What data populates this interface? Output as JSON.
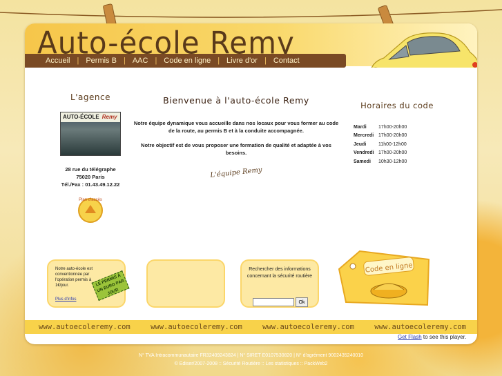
{
  "site": {
    "title": "Auto-école Remy"
  },
  "nav": {
    "items": [
      "Accueil",
      "Permis B",
      "AAC",
      "Code en ligne",
      "Livre d'or",
      "Contact"
    ],
    "separator": "|"
  },
  "agency": {
    "heading": "L'agence",
    "photo_sign": "AUTO-ÉCOLE",
    "photo_sign_brand": "Remy",
    "address_line1": "28 rue du télégraphe",
    "address_line2": "75020 Paris",
    "phone": "Tél./Fax : 01.43.49.12.22",
    "plan_label": "Plan d'accès"
  },
  "welcome": {
    "title": "Bienvenue à l'auto-école Remy",
    "para1": "Notre équipe dynamique vous accueille dans nos locaux pour vous former au code de la route, au permis B et à la conduite accompagnée.",
    "para2": "Notre objectif est de vous proposer une formation de qualité et adaptée à vos besoins.",
    "signature": "L'équipe Remy"
  },
  "hours": {
    "heading": "Horaires du code",
    "rows": [
      {
        "day": "Mardi",
        "time": "17h00-20h00"
      },
      {
        "day": "Mercredi",
        "time": "17h00-20h00"
      },
      {
        "day": "Jeudi",
        "time": "11h00-12h00"
      },
      {
        "day": "Vendredi",
        "time": "17h00-20h00"
      },
      {
        "day": "Samedi",
        "time": "10h30-12h00"
      }
    ]
  },
  "boxes": {
    "convention_text": "Notre auto-école est conventionnée par l'opération permis à 1€/jour.",
    "more_link": "Plus d'infos",
    "stamp_text": "LE PERMIS À UN EURO PAR JOUR",
    "search_text": "Rechercher des informations concernant la sécurité routière",
    "search_button": "Ok",
    "search_value": ""
  },
  "code_tag": {
    "label": "Code en ligne"
  },
  "url_strip": {
    "urls": [
      "www.autoecoleremy.com",
      "www.autoecoleremy.com",
      "www.autoecoleremy.com",
      "www.autoecoleremy.com"
    ]
  },
  "flash": {
    "link": "Get Flash",
    "text": "to see this player."
  },
  "footer": {
    "line1": "N° TVA Intracommunautaire FR32409243824 | N° SIRET E0107530820 | N° d'agrément 9002435240010",
    "line2": "© Ediser/2007-2008 :: Sécurité Routière :: Les statistiques :: PackWeb2"
  },
  "colors": {
    "brown": "#7a4a24",
    "yellow": "#f8d24a",
    "link_blue": "#2a3ab0"
  }
}
